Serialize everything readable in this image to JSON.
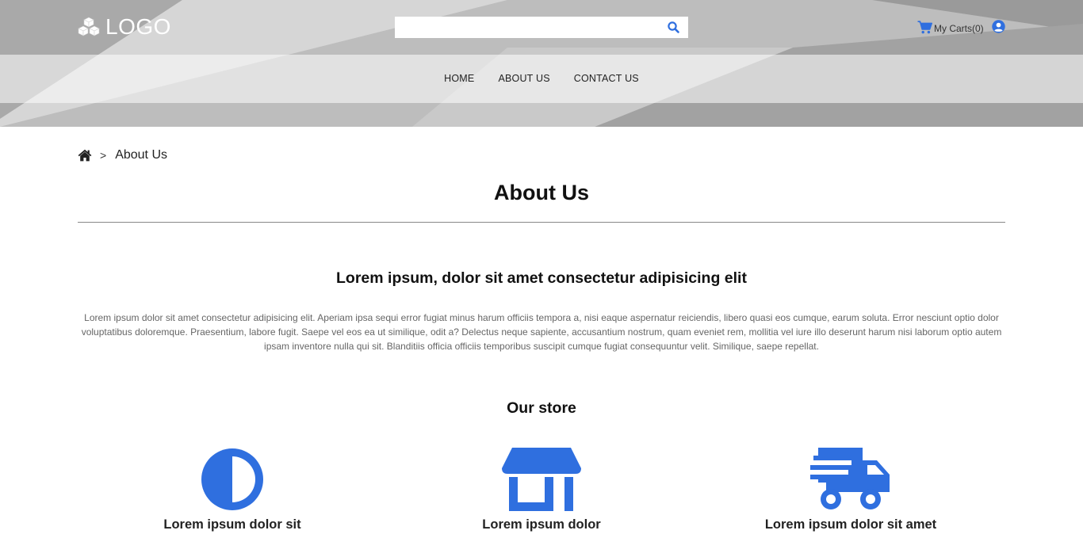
{
  "header": {
    "logo_text": "LOGO",
    "search": {
      "value": "",
      "placeholder": ""
    },
    "cart_label": "My Carts(0)",
    "accent_color": "#2f6fdf"
  },
  "nav": {
    "items": [
      {
        "label": "HOME"
      },
      {
        "label": "ABOUT US"
      },
      {
        "label": "CONTACT US"
      }
    ]
  },
  "breadcrumb": {
    "separator": ">",
    "current": "About Us"
  },
  "page": {
    "title": "About Us",
    "intro_heading": "Lorem ipsum, dolor sit amet consectetur adipisicing elit",
    "intro_text": "Lorem ipsum dolor sit amet consectetur adipisicing elit. Aperiam ipsa sequi error fugiat minus harum officiis tempora a, nisi eaque aspernatur reiciendis, libero quasi eos cumque, earum soluta. Error nesciunt optio dolor voluptatibus doloremque. Praesentium, labore fugit. Saepe vel eos ea ut similique, odit a? Delectus neque sapiente, accusantium nostrum, quam eveniet rem, mollitia vel iure illo deserunt harum nisi laborum optio autem ipsam inventore nulla qui sit. Blanditiis officia officiis temporibus suscipit cumque fugiat consequuntur velit. Similique, saepe repellat.",
    "store_heading": "Our store",
    "features": [
      {
        "icon": "half-circle-icon",
        "label": "Lorem ipsum dolor sit"
      },
      {
        "icon": "store-icon",
        "label": "Lorem ipsum dolor"
      },
      {
        "icon": "delivery-truck-icon",
        "label": "Lorem ipsum dolor sit amet"
      }
    ]
  }
}
